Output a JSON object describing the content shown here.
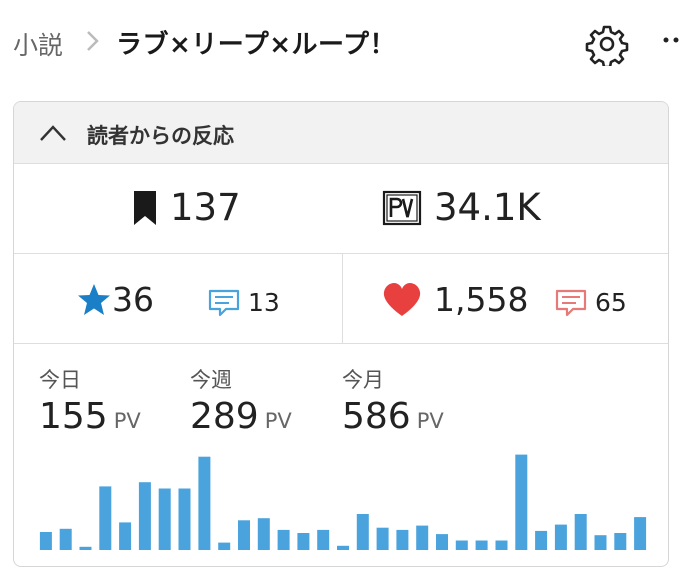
{
  "breadcrumb": {
    "parent": "小説",
    "title": "ラブ×リープ×ループ！"
  },
  "icons": {
    "settings": "gear-icon",
    "more": "more-icon"
  },
  "panel": {
    "title": "読者からの反応",
    "bookmarks": {
      "icon": "bookmark-icon",
      "value": "137"
    },
    "pageviews_total": {
      "icon": "pv-icon",
      "value": "34.1K"
    },
    "stars": {
      "icon": "star-icon",
      "value": "36"
    },
    "star_comments": {
      "icon": "comment-icon",
      "value": "13"
    },
    "hearts": {
      "icon": "heart-icon",
      "value": "1,558"
    },
    "heart_comments": {
      "icon": "comment-icon",
      "value": "65"
    },
    "pv": [
      {
        "label": "今日",
        "value": "155",
        "unit": "PV"
      },
      {
        "label": "今週",
        "value": "289",
        "unit": "PV"
      },
      {
        "label": "今月",
        "value": "586",
        "unit": "PV"
      }
    ]
  },
  "colors": {
    "bar": "#4aa3dd",
    "star": "#1a7fc6",
    "heart": "#e8403f",
    "comment_blue": "#4aa3dd",
    "comment_red": "#e57a78"
  },
  "chart_data": {
    "type": "bar",
    "values": [
      17,
      20,
      3,
      60,
      26,
      64,
      58,
      58,
      88,
      7,
      28,
      30,
      19,
      16,
      19,
      4,
      34,
      21,
      19,
      23,
      15,
      9,
      9,
      9,
      90,
      18,
      24,
      34,
      14,
      16,
      31
    ],
    "ylim": [
      0,
      100
    ]
  }
}
